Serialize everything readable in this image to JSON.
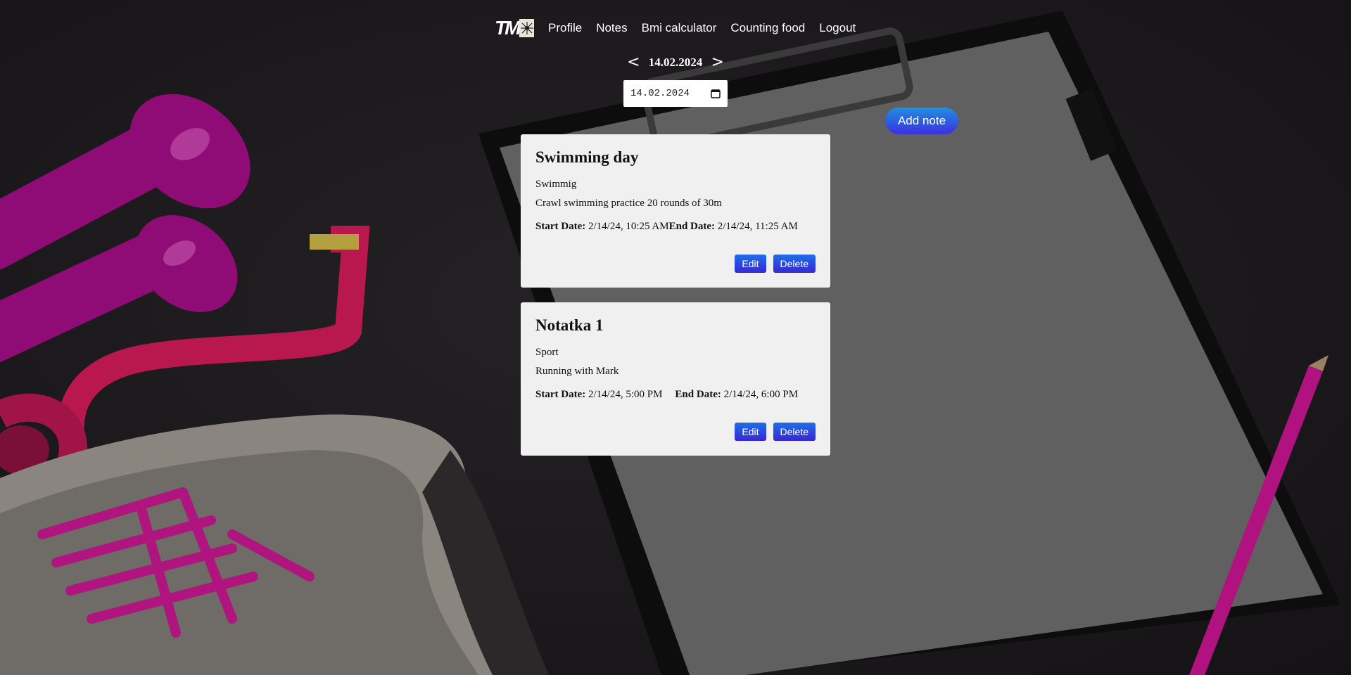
{
  "nav": {
    "logo_text": "TM",
    "links": [
      "Profile",
      "Notes",
      "Bmi calculator",
      "Counting food",
      "Logout"
    ]
  },
  "date_nav": {
    "prev": "<",
    "current": "14.02.2024",
    "next": ">"
  },
  "date_input": {
    "value": "14.02.2024"
  },
  "add_note_label": "Add note",
  "notes": [
    {
      "title": "Swimming day",
      "category": "Swimmig",
      "description": "Crawl swimming practice 20 rounds of 30m",
      "start_label": "Start Date:",
      "start": "2/14/24, 10:25 AM",
      "end_label": "End Date:",
      "end": "2/14/24, 11:25 AM",
      "edit_label": "Edit",
      "delete_label": "Delete"
    },
    {
      "title": "Notatka 1",
      "category": "Sport",
      "description": "Running with Mark",
      "start_label": "Start Date:",
      "start": "2/14/24, 5:00 PM",
      "end_label": "End Date:",
      "end": "2/14/24, 6:00 PM",
      "edit_label": "Edit",
      "delete_label": "Delete"
    }
  ],
  "colors": {
    "background": "#1d1b1d",
    "accent_magenta": "#b0127f",
    "button_gradient_top": "#1d6fe8",
    "button_gradient_bottom": "#3826d8"
  }
}
